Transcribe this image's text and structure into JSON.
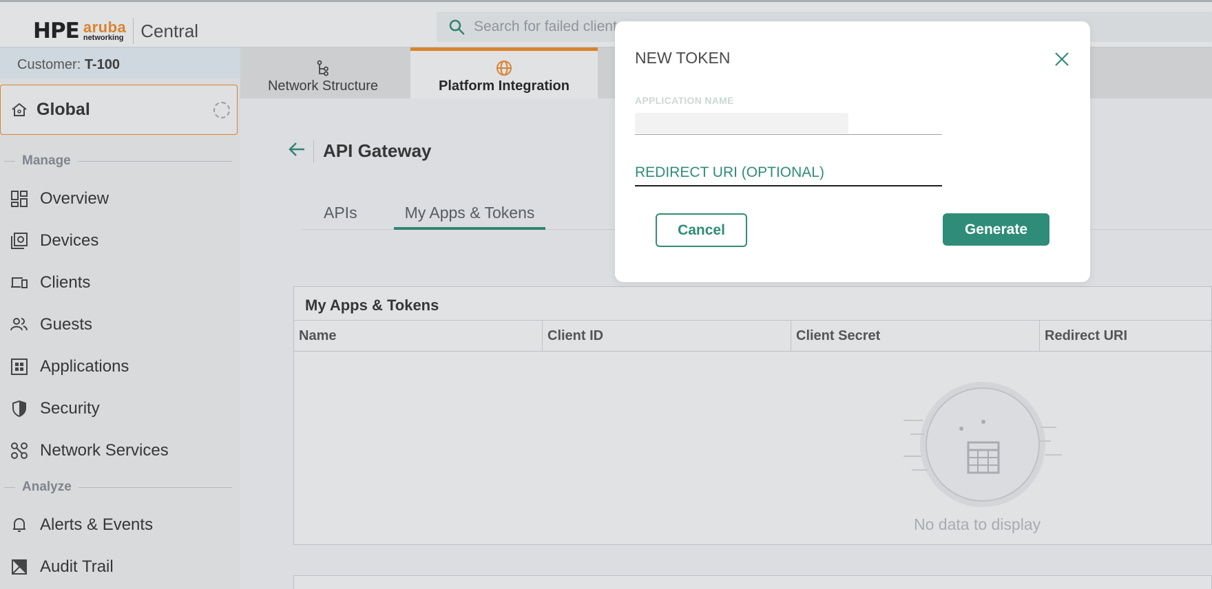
{
  "header": {
    "logo_hpe": "HPE",
    "logo_aruba": "aruba",
    "logo_networking": "networking",
    "product": "Central",
    "search_placeholder": "Search for failed clients"
  },
  "sidebar": {
    "customer_label": "Customer:",
    "customer_value": "T-100",
    "scope": "Global",
    "sections": {
      "manage": "Manage",
      "analyze": "Analyze"
    },
    "items": [
      {
        "label": "Overview",
        "icon": "grid-icon"
      },
      {
        "label": "Devices",
        "icon": "devices-icon"
      },
      {
        "label": "Clients",
        "icon": "clients-icon"
      },
      {
        "label": "Guests",
        "icon": "guests-icon"
      },
      {
        "label": "Applications",
        "icon": "applications-icon"
      },
      {
        "label": "Security",
        "icon": "shield-icon"
      },
      {
        "label": "Network Services",
        "icon": "network-services-icon"
      },
      {
        "label": "Alerts & Events",
        "icon": "bell-icon"
      },
      {
        "label": "Audit Trail",
        "icon": "audit-icon"
      }
    ]
  },
  "top_tabs": [
    {
      "label": "Network Structure",
      "icon": "hierarchy-icon"
    },
    {
      "label": "Platform Integration",
      "icon": "globe-icon"
    }
  ],
  "page": {
    "title": "API Gateway",
    "subtabs": [
      "APIs",
      "My Apps & Tokens"
    ],
    "card_title": "My Apps & Tokens",
    "columns": [
      "Name",
      "Client ID",
      "Client Secret",
      "Redirect URI"
    ],
    "empty": "No data to display"
  },
  "modal": {
    "title": "NEW TOKEN",
    "app_name_label": "APPLICATION NAME",
    "redirect_label": "REDIRECT URI (OPTIONAL)",
    "cancel": "Cancel",
    "generate": "Generate"
  },
  "colors": {
    "accent": "#2f8c78",
    "brand_orange": "#f28c28"
  }
}
